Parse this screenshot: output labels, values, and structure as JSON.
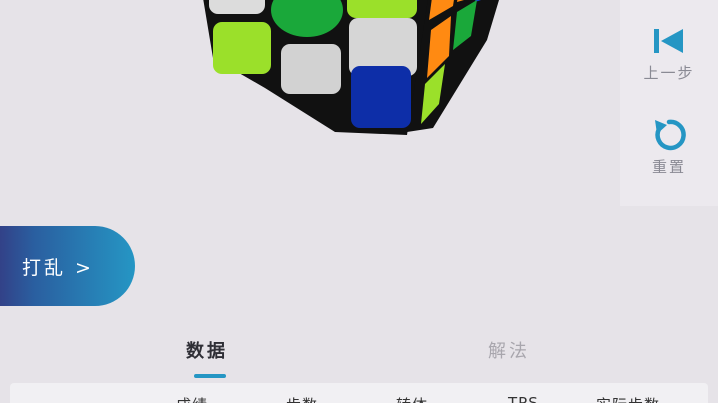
{
  "side_panel": {
    "undo": {
      "label": "上一步",
      "icon": "step-back-icon"
    },
    "reset": {
      "label": "重置",
      "icon": "reset-icon"
    }
  },
  "scramble_button": {
    "label": "打乱 >"
  },
  "tabs": [
    {
      "label": "数据",
      "active": true
    },
    {
      "label": "解法",
      "active": false
    }
  ],
  "table": {
    "headers": [
      "成绩",
      "步数",
      "转体",
      "TPS",
      "实际步数"
    ]
  },
  "colors": {
    "accent": "#2596c4",
    "scramble_gradient_start": "#37307a",
    "cube_green": "#1aa83a",
    "cube_lime": "#9be02a",
    "cube_orange": "#ff8a12",
    "cube_blue": "#0d2ea8",
    "cube_white": "#dcdcdc"
  }
}
